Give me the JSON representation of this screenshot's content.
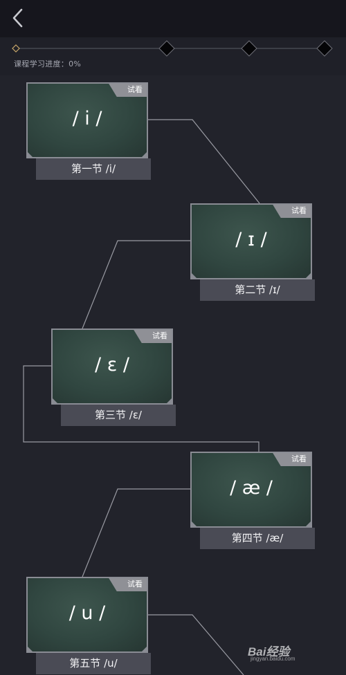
{
  "header": {
    "back_icon": "chevron-left-icon"
  },
  "progress": {
    "label": "课程学习进度：0%",
    "value": 0,
    "milestone_icon": "diamond-icon"
  },
  "lessons": [
    {
      "symbol": "/ i /",
      "title": "第一节 /i/",
      "badge": "试看"
    },
    {
      "symbol": "/ ɪ /",
      "title": "第二节 /ɪ/",
      "badge": "试看"
    },
    {
      "symbol": "/ ɛ /",
      "title": "第三节 /ɛ/",
      "badge": "试看"
    },
    {
      "symbol": "/ æ /",
      "title": "第四节 /æ/",
      "badge": "试看"
    },
    {
      "symbol": "/ u /",
      "title": "第五节 /u/",
      "badge": "试看"
    }
  ],
  "colors": {
    "background": "#22232b",
    "topbar": "#16161d",
    "board": "#304640",
    "plate": "#4a4b55",
    "badge": "#8f9096",
    "connector": "#9a9ba3"
  },
  "watermark": {
    "logo": "Bai经验",
    "url": "jingyan.baidu.com"
  }
}
